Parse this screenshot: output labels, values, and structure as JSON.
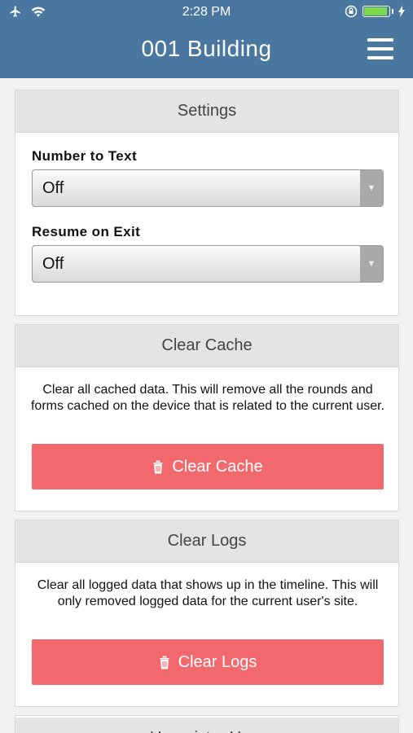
{
  "status_bar": {
    "time": "2:28 PM"
  },
  "header": {
    "title": "001 Building"
  },
  "settings": {
    "heading": "Settings",
    "number_to_text": {
      "label": "Number to Text",
      "value": "Off"
    },
    "resume_on_exit": {
      "label": "Resume on Exit",
      "value": "Off"
    }
  },
  "clear_cache": {
    "heading": "Clear Cache",
    "description": "Clear all cached data. This will remove all the rounds and forms cached on the device that is related to the current user.",
    "button_label": "Clear Cache"
  },
  "clear_logs": {
    "heading": "Clear Logs",
    "description": "Clear all logged data that shows up in the timeline. This will only removed logged data for the current user's site.",
    "button_label": "Clear Logs"
  },
  "unregister": {
    "heading": "Unregister User"
  },
  "colors": {
    "header": "#4a77a0",
    "danger": "#f2696d",
    "battery": "#7bd94a"
  }
}
